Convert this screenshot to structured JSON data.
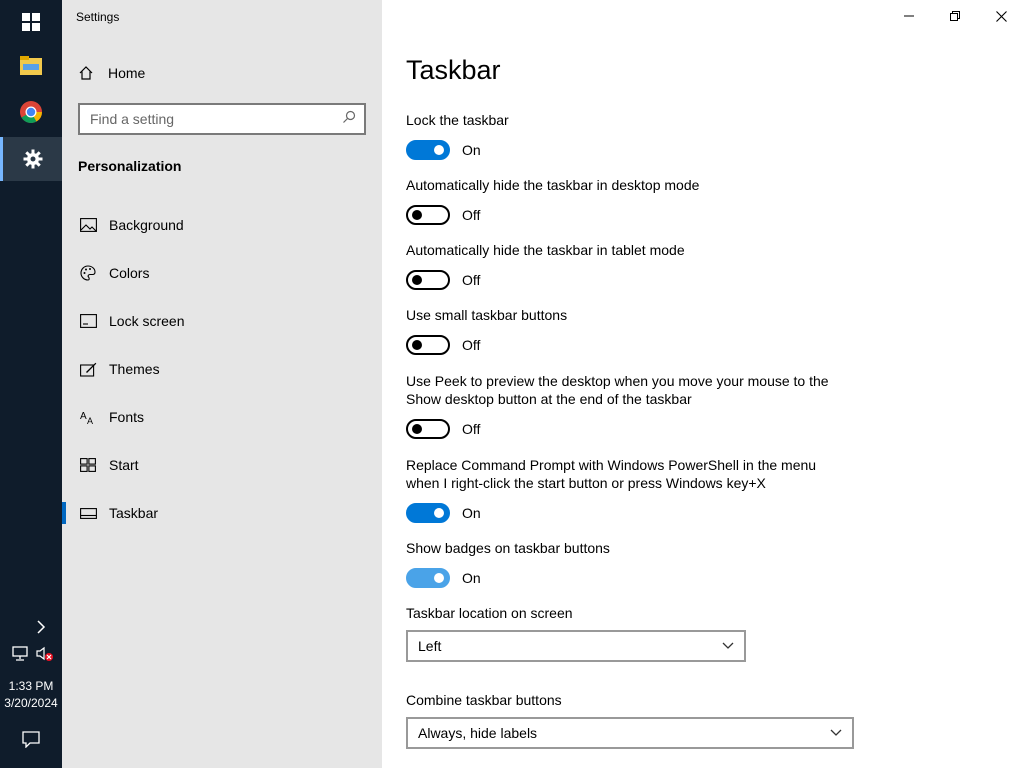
{
  "taskbar": {
    "icons": [
      "windows-logo-icon",
      "file-explorer-icon",
      "chrome-icon",
      "settings-icon"
    ],
    "tray_icons": [
      "chevron-right-icon",
      "network-icon",
      "volume-muted-icon"
    ],
    "time": "1:33 PM",
    "date": "3/20/2024",
    "notification_icon": "action-center-icon"
  },
  "nav": {
    "app_title": "Settings",
    "home_label": "Home",
    "search_placeholder": "Find a setting",
    "section_label": "Personalization",
    "items": [
      {
        "label": "Background",
        "icon": "image-icon"
      },
      {
        "label": "Colors",
        "icon": "palette-icon"
      },
      {
        "label": "Lock screen",
        "icon": "lock-screen-icon"
      },
      {
        "label": "Themes",
        "icon": "themes-icon"
      },
      {
        "label": "Fonts",
        "icon": "fonts-icon"
      },
      {
        "label": "Start",
        "icon": "start-icon"
      },
      {
        "label": "Taskbar",
        "icon": "taskbar-icon",
        "selected": true
      }
    ]
  },
  "content": {
    "title": "Taskbar",
    "settings": [
      {
        "label": "Lock the taskbar",
        "state": "On"
      },
      {
        "label": "Automatically hide the taskbar in desktop mode",
        "state": "Off"
      },
      {
        "label": "Automatically hide the taskbar in tablet mode",
        "state": "Off"
      },
      {
        "label": "Use small taskbar buttons",
        "state": "Off"
      },
      {
        "label": "Use Peek to preview the desktop when you move your mouse to the Show desktop button at the end of the taskbar",
        "state": "Off"
      },
      {
        "label": "Replace Command Prompt with Windows PowerShell in the menu when I right-click the start button or press Windows key+X",
        "state": "On"
      },
      {
        "label": "Show badges on taskbar buttons",
        "state": "On"
      }
    ],
    "location": {
      "label": "Taskbar location on screen",
      "value": "Left"
    },
    "combine": {
      "label": "Combine taskbar buttons",
      "value": "Always, hide labels"
    }
  },
  "colors": {
    "accent": "#0078d7",
    "taskbar_bg": "#0f1c2b",
    "nav_bg": "#e6e6e6"
  }
}
